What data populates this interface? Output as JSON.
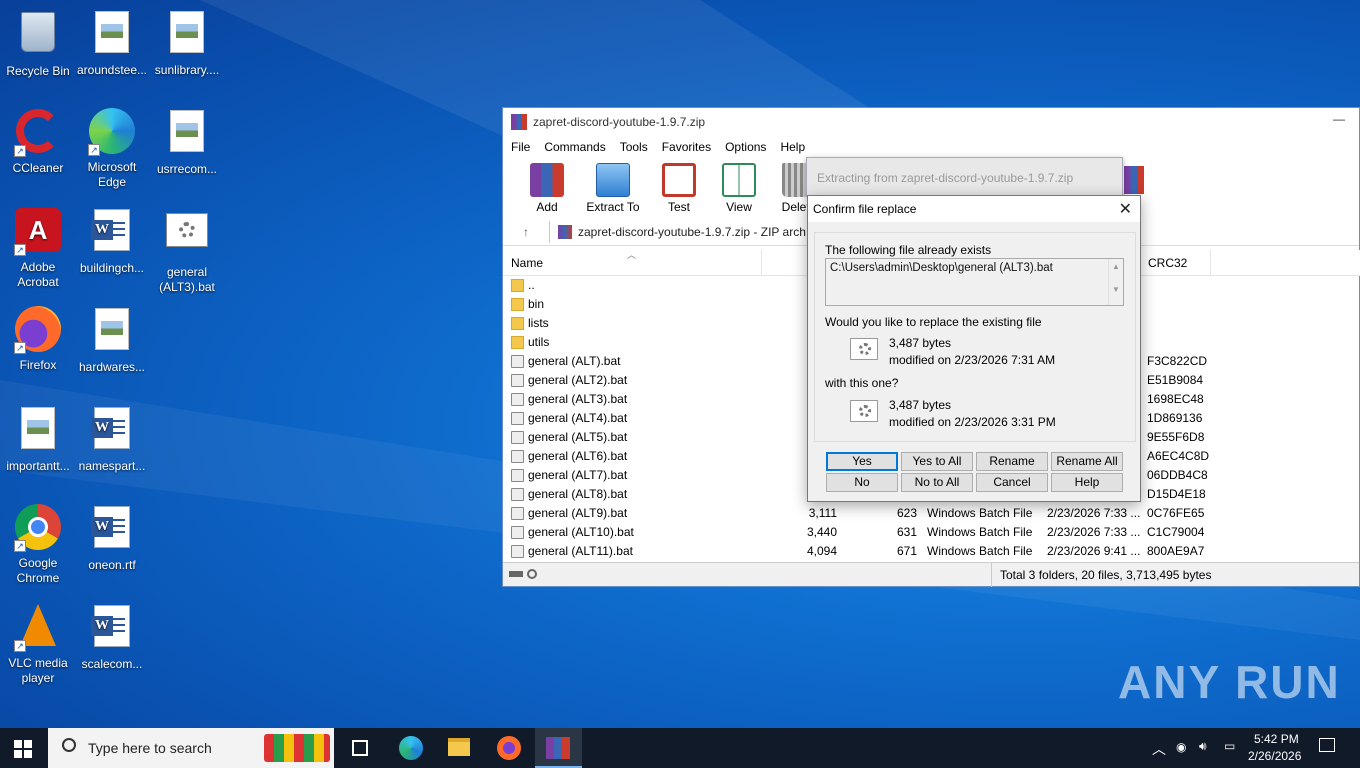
{
  "desktop": {
    "icons": [
      {
        "label": "Recycle Bin",
        "icon": "recycle-bin-icon"
      },
      {
        "label": "aroundstee...",
        "icon": "image-file-icon"
      },
      {
        "label": "sunlibrary....",
        "icon": "image-file-icon"
      },
      {
        "label": "CCleaner",
        "icon": "ccleaner-icon"
      },
      {
        "label": "Microsoft Edge",
        "icon": "edge-icon"
      },
      {
        "label": "usrrecom...",
        "icon": "image-file-icon"
      },
      {
        "label": "Adobe Acrobat",
        "icon": "acrobat-icon"
      },
      {
        "label": "buildingch...",
        "icon": "word-doc-icon"
      },
      {
        "label": "general (ALT3).bat",
        "icon": "batch-file-icon"
      },
      {
        "label": "Firefox",
        "icon": "firefox-icon"
      },
      {
        "label": "hardwares...",
        "icon": "image-file-icon"
      },
      {
        "label": "importantt...",
        "icon": "image-file-icon"
      },
      {
        "label": "namespart...",
        "icon": "word-doc-icon"
      },
      {
        "label": "Google Chrome",
        "icon": "chrome-icon"
      },
      {
        "label": "oneon.rtf",
        "icon": "word-doc-icon"
      },
      {
        "label": "VLC media player",
        "icon": "vlc-icon"
      },
      {
        "label": "scalecom...",
        "icon": "word-doc-icon"
      }
    ]
  },
  "winrar": {
    "title": "zapret-discord-youtube-1.9.7.zip",
    "menu": [
      "File",
      "Commands",
      "Tools",
      "Favorites",
      "Options",
      "Help"
    ],
    "toolbar": [
      "Add",
      "Extract To",
      "Test",
      "View",
      "Delete"
    ],
    "path": "zapret-discord-youtube-1.9.7.zip - ZIP arch",
    "columns": {
      "name": "Name",
      "crc": "CRC32"
    },
    "rows": [
      {
        "name": "..",
        "size": "",
        "packed": "",
        "type": "",
        "modified": "",
        "crc": "",
        "folder": true
      },
      {
        "name": "bin",
        "size": "3,30",
        "packed": "",
        "type": "",
        "modified": "",
        "crc": "",
        "folder": true
      },
      {
        "name": "lists",
        "size": "27",
        "packed": "",
        "type": "",
        "modified": "",
        "crc": "",
        "folder": true
      },
      {
        "name": "utils",
        "size": "3",
        "packed": "",
        "type": "",
        "modified": "",
        "crc": "",
        "folder": true
      },
      {
        "name": "general (ALT).bat",
        "size": "",
        "packed": "",
        "type": "",
        "modified": "",
        "crc": "F3C822CD"
      },
      {
        "name": "general (ALT2).bat",
        "size": "",
        "packed": "",
        "type": "",
        "modified": "",
        "crc": "E51B9084"
      },
      {
        "name": "general (ALT3).bat",
        "size": "",
        "packed": "",
        "type": "",
        "modified": "",
        "crc": "1698EC48"
      },
      {
        "name": "general (ALT4).bat",
        "size": "",
        "packed": "",
        "type": "",
        "modified": "",
        "crc": "1D869136"
      },
      {
        "name": "general (ALT5).bat",
        "size": "",
        "packed": "",
        "type": "",
        "modified": "",
        "crc": "9E55F6D8"
      },
      {
        "name": "general (ALT6).bat",
        "size": "",
        "packed": "",
        "type": "",
        "modified": "",
        "crc": "A6EC4C8D"
      },
      {
        "name": "general (ALT7).bat",
        "size": "",
        "packed": "",
        "type": "",
        "modified": "",
        "crc": "06DDB4C8"
      },
      {
        "name": "general (ALT8).bat",
        "size": "",
        "packed": "",
        "type": "",
        "modified": "",
        "crc": "D15D4E18"
      },
      {
        "name": "general (ALT9).bat",
        "size": "3,111",
        "packed": "623",
        "type": "Windows Batch File",
        "modified": "2/23/2026 7:33 ...",
        "crc": "0C76FE65"
      },
      {
        "name": "general (ALT10).bat",
        "size": "3,440",
        "packed": "631",
        "type": "Windows Batch File",
        "modified": "2/23/2026 7:33 ...",
        "crc": "C1C79004"
      },
      {
        "name": "general (ALT11).bat",
        "size": "4,094",
        "packed": "671",
        "type": "Windows Batch File",
        "modified": "2/23/2026 9:41 ...",
        "crc": "800AE9A7"
      }
    ],
    "status": "Total 3 folders, 20 files, 3,713,495 bytes"
  },
  "progress_dialog": {
    "title": "Extracting from zapret-discord-youtube-1.9.7.zip"
  },
  "confirm": {
    "title": "Confirm file replace",
    "exists_label": "The following file already exists",
    "filepath": "C:\\Users\\admin\\Desktop\\general (ALT3).bat",
    "question": "Would you like to replace the existing file",
    "old_size": "3,487 bytes",
    "old_modified": "modified on 2/23/2026 7:31 AM",
    "with_label": "with this one?",
    "new_size": "3,487 bytes",
    "new_modified": "modified on 2/23/2026 3:31 PM",
    "buttons": {
      "yes": "Yes",
      "yes_all": "Yes to All",
      "rename": "Rename",
      "rename_all": "Rename All",
      "no": "No",
      "no_all": "No to All",
      "cancel": "Cancel",
      "help": "Help"
    }
  },
  "taskbar": {
    "search_placeholder": "Type here to search",
    "time": "5:42 PM",
    "date": "2/26/2026"
  },
  "watermark": "ANY RUN"
}
